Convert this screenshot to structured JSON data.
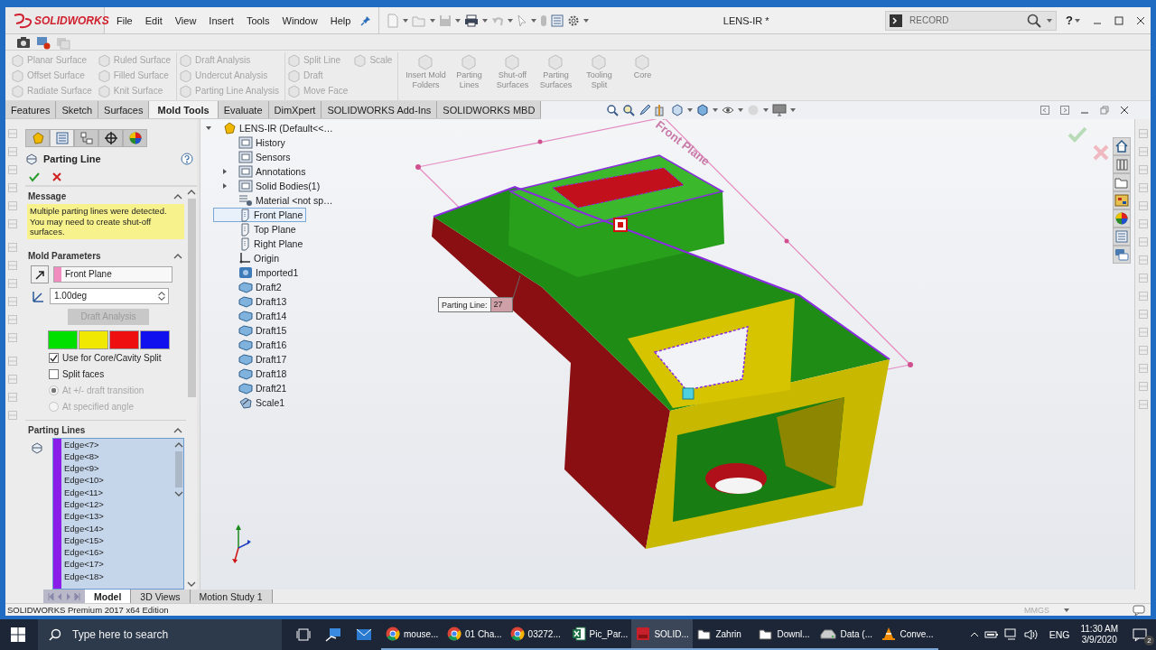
{
  "window": {
    "title": "LENS-IR *"
  },
  "logo": {
    "text": "SOLIDWORKS"
  },
  "menu": [
    "File",
    "Edit",
    "View",
    "Insert",
    "Tools",
    "Window",
    "Help"
  ],
  "search": {
    "placeholder": "RECORD"
  },
  "help_button": "?",
  "command_groups": [
    {
      "columns": [
        [
          {
            "label": "Planar Surface",
            "disabled": true
          },
          {
            "label": "Offset Surface",
            "disabled": true
          },
          {
            "label": "Radiate Surface",
            "disabled": true
          }
        ],
        [
          {
            "label": "Ruled Surface",
            "disabled": true
          },
          {
            "label": "Filled Surface",
            "disabled": true
          },
          {
            "label": "Knit Surface",
            "disabled": true
          }
        ]
      ]
    },
    {
      "columns": [
        [
          {
            "label": "Draft Analysis",
            "disabled": true
          },
          {
            "label": "Undercut Analysis",
            "disabled": true
          },
          {
            "label": "Parting Line Analysis",
            "disabled": true
          }
        ]
      ]
    },
    {
      "columns": [
        [
          {
            "label": "Split Line",
            "disabled": true
          },
          {
            "label": "Draft",
            "disabled": true
          },
          {
            "label": "Move Face",
            "disabled": true
          }
        ],
        [
          {
            "label": "Scale",
            "disabled": true
          }
        ]
      ]
    }
  ],
  "large_commands": [
    {
      "label": "Insert Mold Folders",
      "disabled": true
    },
    {
      "label": "Parting Lines",
      "disabled": true
    },
    {
      "label": "Shut-off Surfaces",
      "disabled": true
    },
    {
      "label": "Parting Surfaces",
      "disabled": true
    },
    {
      "label": "Tooling Split",
      "disabled": true
    },
    {
      "label": "Core",
      "disabled": true
    }
  ],
  "tabs": [
    {
      "label": "Features",
      "selected": false
    },
    {
      "label": "Sketch",
      "selected": false
    },
    {
      "label": "Surfaces",
      "selected": false
    },
    {
      "label": "Mold Tools",
      "selected": true
    },
    {
      "label": "Evaluate",
      "selected": false
    },
    {
      "label": "DimXpert",
      "selected": false
    },
    {
      "label": "SOLIDWORKS Add-Ins",
      "selected": false
    },
    {
      "label": "SOLIDWORKS MBD",
      "selected": false
    }
  ],
  "property_manager": {
    "tabs": [
      {
        "selected": false
      },
      {
        "selected": true
      },
      {
        "selected": false
      },
      {
        "selected": false
      },
      {
        "selected": false
      }
    ],
    "title": "Parting Line",
    "message": {
      "title": "Message",
      "text": "Multiple parting lines were detected. You may need to create shut-off surfaces."
    },
    "mold_parameters": {
      "title": "Mold Parameters",
      "direction": "Front Plane",
      "angle": "1.00deg",
      "button": {
        "label": "Draft Analysis",
        "disabled": true
      },
      "swatches": [
        {
          "color": "#00e000"
        },
        {
          "color": "#f0e800"
        },
        {
          "color": "#ee1010"
        },
        {
          "color": "#1010ee"
        }
      ],
      "checkboxes": [
        {
          "label": "Use for Core/Cavity Split",
          "checked": true
        },
        {
          "label": "Split faces",
          "checked": false
        }
      ],
      "radios": [
        {
          "label": "At +/- draft transition",
          "selected": true,
          "disabled": true
        },
        {
          "label": "At specified angle",
          "selected": false,
          "disabled": true
        }
      ]
    },
    "parting_lines": {
      "title": "Parting Lines",
      "items": [
        "Edge<7>",
        "Edge<8>",
        "Edge<9>",
        "Edge<10>",
        "Edge<11>",
        "Edge<12>",
        "Edge<13>",
        "Edge<14>",
        "Edge<15>",
        "Edge<16>",
        "Edge<17>",
        "Edge<18>"
      ]
    }
  },
  "feature_tree": {
    "root": {
      "label": "LENS-IR (Default<<…",
      "expanded": true
    },
    "items": [
      {
        "label": "History",
        "kind": "folder",
        "selected": false
      },
      {
        "label": "Sensors",
        "kind": "folder",
        "selected": false
      },
      {
        "label": "Annotations",
        "kind": "folder",
        "selected": false,
        "expanded": false
      },
      {
        "label": "Solid Bodies(1)",
        "kind": "folder",
        "selected": false,
        "expanded": false
      },
      {
        "label": "Material <not sp…",
        "kind": "material",
        "selected": false
      },
      {
        "label": "Front Plane",
        "kind": "plane",
        "selected": true
      },
      {
        "label": "Top Plane",
        "kind": "plane",
        "selected": false
      },
      {
        "label": "Right Plane",
        "kind": "plane",
        "selected": false
      },
      {
        "label": "Origin",
        "kind": "origin",
        "selected": false
      },
      {
        "label": "Imported1",
        "kind": "imported",
        "selected": false
      },
      {
        "label": "Draft2",
        "kind": "draft",
        "selected": false
      },
      {
        "label": "Draft13",
        "kind": "draft",
        "selected": false
      },
      {
        "label": "Draft14",
        "kind": "draft",
        "selected": false
      },
      {
        "label": "Draft15",
        "kind": "draft",
        "selected": false
      },
      {
        "label": "Draft16",
        "kind": "draft",
        "selected": false
      },
      {
        "label": "Draft17",
        "kind": "draft",
        "selected": false
      },
      {
        "label": "Draft18",
        "kind": "draft",
        "selected": false
      },
      {
        "label": "Draft21",
        "kind": "draft",
        "selected": false
      },
      {
        "label": "Scale1",
        "kind": "scale",
        "selected": false
      }
    ]
  },
  "viewport": {
    "plane_label": "Front Plane",
    "callout": {
      "label": "Parting Line:",
      "value": "27"
    }
  },
  "bottom_tabs": [
    {
      "label": "Model",
      "selected": true
    },
    {
      "label": "3D Views",
      "selected": false
    },
    {
      "label": "Motion Study 1",
      "selected": false
    }
  ],
  "status_bar": {
    "text": "SOLIDWORKS Premium 2017 x64 Edition",
    "units": "MMGS"
  },
  "taskbar": {
    "search_placeholder": "Type here to search",
    "apps": [
      {
        "label": "mouse...",
        "kind": "browser",
        "active": false
      },
      {
        "label": "01 Cha...",
        "kind": "browser",
        "active": false
      },
      {
        "label": "03272...",
        "kind": "browser",
        "active": false
      },
      {
        "label": "Pic_Par...",
        "kind": "spreadsheet",
        "active": false
      },
      {
        "label": "SOLID...",
        "kind": "cad",
        "active": true
      },
      {
        "label": "Zahrin",
        "kind": "folder",
        "active": false
      },
      {
        "label": "Downl...",
        "kind": "folder",
        "active": false
      },
      {
        "label": "Data (...",
        "kind": "drive",
        "active": false
      },
      {
        "label": "Conve...",
        "kind": "cone",
        "active": false
      }
    ],
    "language": "ENG",
    "time": "11:30 AM",
    "date": "3/9/2020",
    "notifications": "2"
  }
}
